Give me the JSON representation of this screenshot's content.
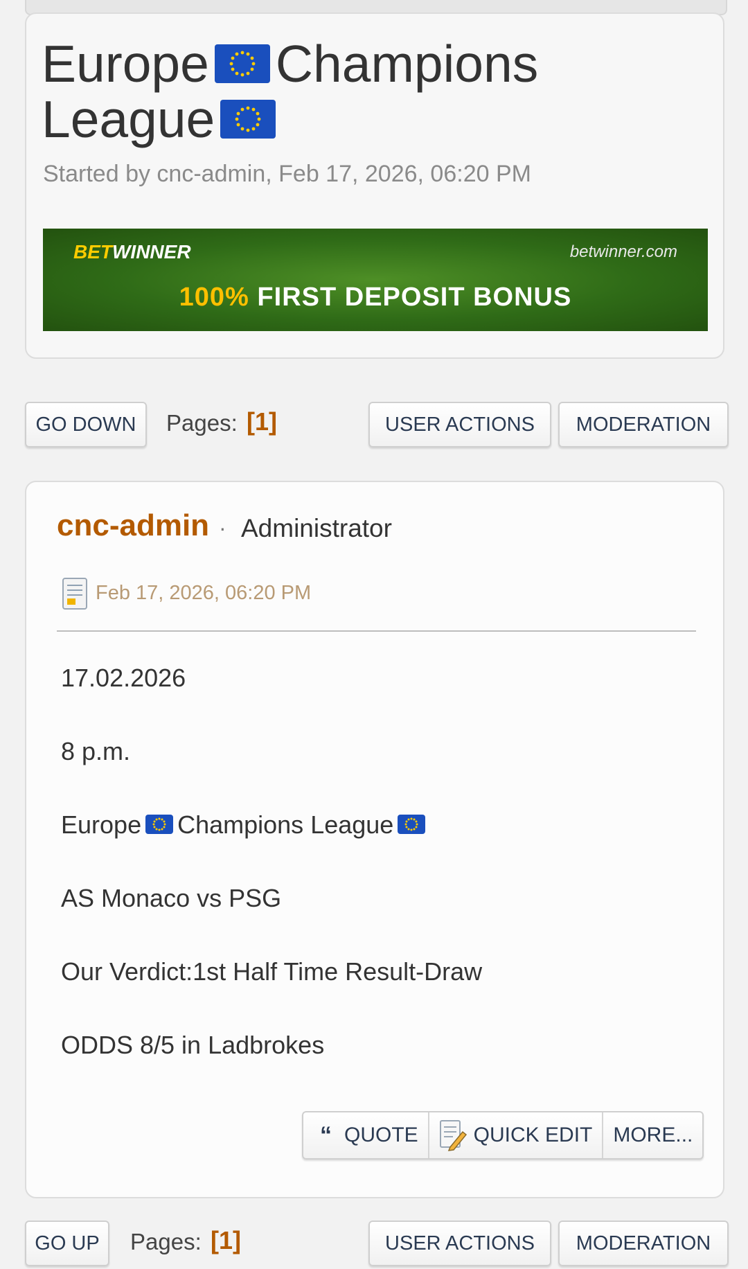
{
  "topic": {
    "title_line1": "Europe",
    "title_word2": "Champions",
    "title_line2": "League",
    "started_by": "Started by cnc-admin, Feb 17, 2026, 06:20 PM",
    "flag_icon": "eu-flag-icon"
  },
  "banner": {
    "brand_bet": "BET",
    "brand_winner": "WINNER",
    "site": "betwinner.com",
    "bonus_pct": "100%",
    "bonus_text": "FIRST DEPOSIT BONUS"
  },
  "nav_top": {
    "go_label": "GO DOWN",
    "pages_label": "Pages:",
    "pages_value": "[1]",
    "user_actions": "USER ACTIONS",
    "moderation": "MODERATION"
  },
  "post": {
    "author": "cnc-admin",
    "separator": "·",
    "role": "Administrator",
    "date": "Feb 17, 2026, 06:20 PM",
    "lines": {
      "date": "17.02.2026",
      "time": "8 p.m.",
      "league_a": "Europe",
      "league_b": "Champions League",
      "match": "AS Monaco vs PSG",
      "verdict": "Our Verdict:1st Half Time Result-Draw",
      "odds": "ODDS 8/5 in Ladbrokes"
    },
    "tools": {
      "quote": "QUOTE",
      "quick_edit": "QUICK EDIT",
      "more": "MORE..."
    }
  },
  "nav_bottom": {
    "go_label": "GO UP",
    "pages_label": "Pages:",
    "pages_value": "[1]",
    "user_actions": "USER ACTIONS",
    "moderation": "MODERATION"
  },
  "colors": {
    "accent": "#b35a00",
    "flag_blue": "#1a4fbd",
    "flag_star": "#ffcc00"
  }
}
